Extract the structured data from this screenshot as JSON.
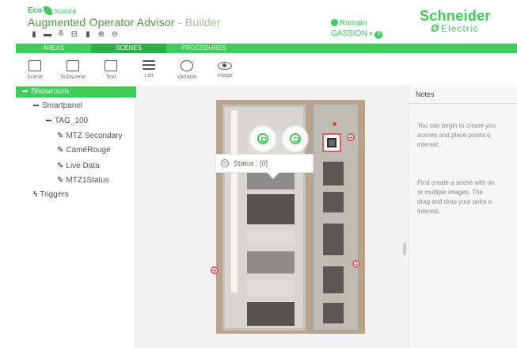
{
  "header": {
    "brand_eco": "Eco",
    "brand_struxure": "truxure",
    "app_title": "Augmented Operator Advisor",
    "app_subtitle": " - Builder",
    "user_line1": "Romain",
    "user_line2": "GASSION",
    "vendor_line1": "Schneider",
    "vendor_line2": "Electric"
  },
  "nav": {
    "tabs": [
      {
        "label": "AREAS"
      },
      {
        "label": "SCENES"
      },
      {
        "label": "PROCEDURES"
      }
    ],
    "active": "SCENES"
  },
  "tools": [
    {
      "label": "Scene",
      "icon": "scene-icon"
    },
    {
      "label": "Subscene",
      "icon": "subscene-icon"
    },
    {
      "label": "Text",
      "icon": "text-icon"
    },
    {
      "label": "List",
      "icon": "list-icon"
    },
    {
      "label": "Variable",
      "icon": "variable-icon"
    },
    {
      "label": "Image",
      "icon": "eye-icon"
    }
  ],
  "tree": {
    "root": "Showroom",
    "child": "Smartpanel",
    "tag": "TAG_100",
    "points": [
      "MTZ Secondary",
      "CaméRouge",
      "Live Data",
      "MTZ1Status"
    ],
    "triggers": "Triggers"
  },
  "canvas": {
    "tooltip": "Status : [0]"
  },
  "notes": {
    "title": "Notes",
    "p1": [
      "You can begin to create you",
      "scenes and place points o",
      "interest."
    ],
    "p2": [
      "First create a scene with on",
      "or multiple images. The",
      "drag and drop your point o",
      "interest."
    ]
  },
  "colors": {
    "accent": "#3dcd58",
    "marker": "#e65a60"
  }
}
